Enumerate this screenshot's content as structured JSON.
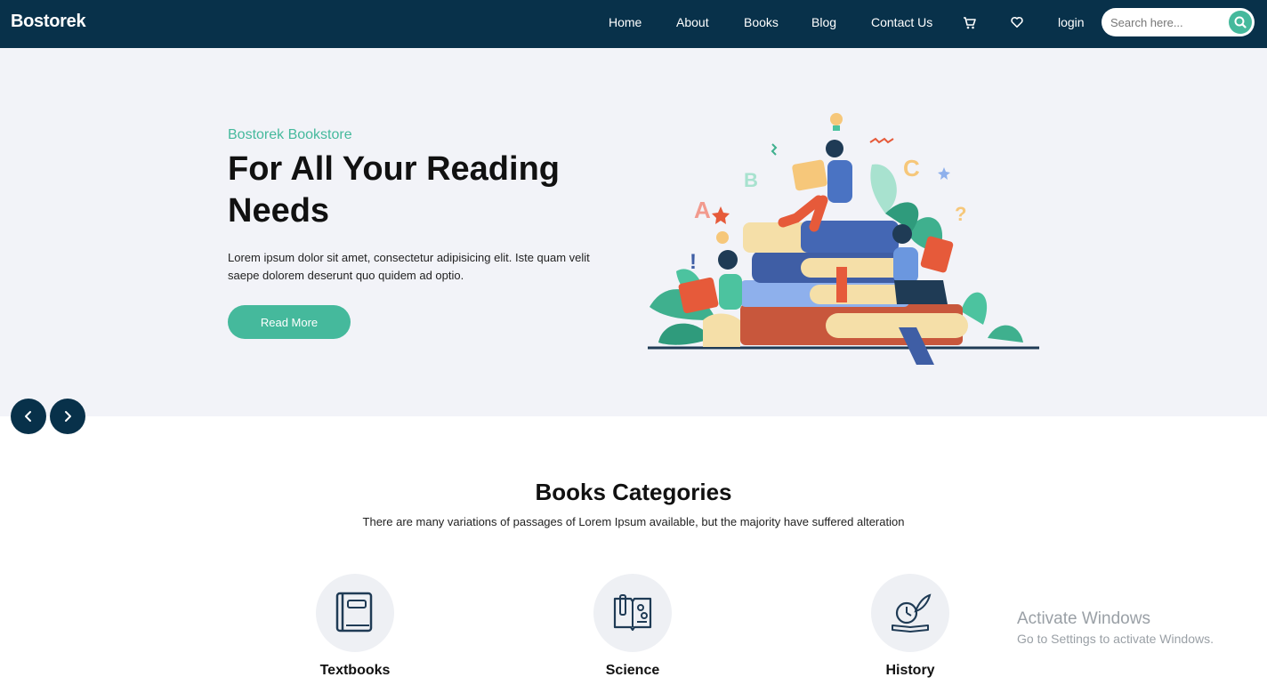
{
  "nav": {
    "brand": "Bostorek",
    "links": [
      "Home",
      "About",
      "Books",
      "Blog",
      "Contact Us"
    ],
    "cart_icon": "cart-icon",
    "wishlist_icon": "heart-icon",
    "login": "login",
    "search_placeholder": "Search here..."
  },
  "hero": {
    "subtitle": "Bostorek Bookstore",
    "title": "For All Your Reading Needs",
    "text": "Lorem ipsum dolor sit amet, consectetur adipisicing elit. Iste quam velit saepe dolorem deserunt quo quidem ad optio.",
    "button": "Read More",
    "illustration": "people-reading-books-illustration"
  },
  "carousel": {
    "prev_icon": "chevron-left-icon",
    "next_icon": "chevron-right-icon"
  },
  "categories": {
    "title": "Books Categories",
    "subtitle": "There are many variations of passages of Lorem Ipsum available, but the majority have suffered alteration",
    "items": [
      {
        "label": "Textbooks",
        "icon": "textbook-icon"
      },
      {
        "label": "Science",
        "icon": "science-icon"
      },
      {
        "label": "History",
        "icon": "history-icon"
      }
    ]
  },
  "watermark": {
    "title": "Activate Windows",
    "subtitle": "Go to Settings to activate Windows."
  },
  "colors": {
    "navy": "#08314a",
    "accent": "#45b99c",
    "hero_bg": "#f2f3f8"
  }
}
